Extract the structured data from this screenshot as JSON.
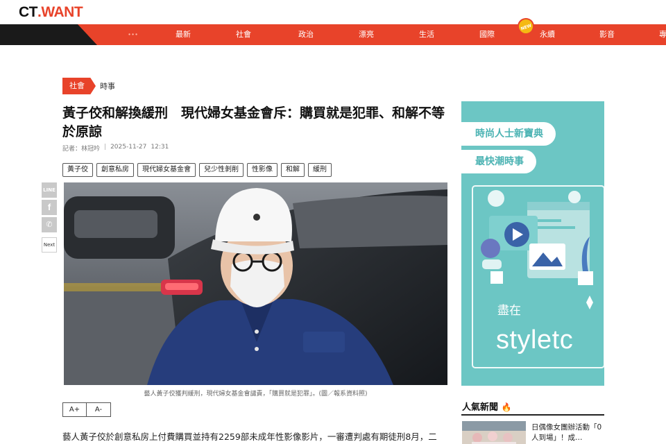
{
  "logo": {
    "ct": "CT",
    "dot": ".",
    "want": "WANT"
  },
  "nav": {
    "dots": "∙∙∙",
    "items": [
      "最新",
      "社會",
      "政治",
      "漂亮",
      "生活",
      "國際",
      "永續",
      "影音",
      "專"
    ],
    "new_badge": "NEW"
  },
  "breadcrumb": {
    "category": "社會",
    "subcategory": "時事"
  },
  "article": {
    "title": "黃子佼和解換緩刑　現代婦女基金會斥：購買就是犯罪、和解不等於原諒",
    "author": "記者：林冠吟",
    "date": "2025-11-27",
    "time": "12:31",
    "tags": [
      "黃子佼",
      "創意私房",
      "現代婦女基金會",
      "兒少性剝削",
      "性影像",
      "和解",
      "緩刑"
    ],
    "caption": "藝人黃子佼獲判緩刑，現代婦女基金會譴責，「購買就是犯罪」。(圖／報系資料照)",
    "font_larger": "A+",
    "font_smaller": "A-",
    "lead": "藝人黃子佼於創意私房上付費購買並持有2259部未成年性影像影片，一審遭判處有期徒刑8月，二"
  },
  "share": {
    "line": "LINE",
    "facebook": "f",
    "wechat": "✆",
    "next": "Next"
  },
  "ad": {
    "line1": "時尚人士新寶典",
    "line2": "最快潮時事",
    "small": "盡在",
    "brand": "styletc"
  },
  "popular": {
    "title": "人氣新聞",
    "item_text": "日偶像女團辦活動「0人到場」！成…"
  },
  "colors": {
    "accent": "#e8432a",
    "ad_bg": "#6cc6c4",
    "nav_dark": "#1a1a1a"
  }
}
